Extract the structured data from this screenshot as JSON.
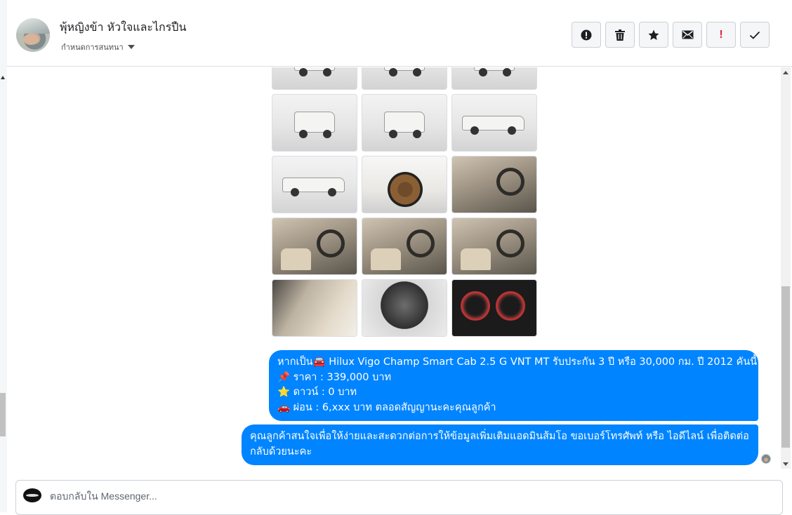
{
  "header": {
    "contact_name": "พุ้หญิงข้า หัวใจและไกรปืน",
    "conversation_settings": "กำหนดการสนทนา"
  },
  "toolbar": {
    "buttons": [
      {
        "name": "report-spam-button",
        "icon": "alert-circle-icon"
      },
      {
        "name": "delete-button",
        "icon": "trash-icon"
      },
      {
        "name": "star-button",
        "icon": "star-icon"
      },
      {
        "name": "mark-unread-button",
        "icon": "envelope-icon"
      },
      {
        "name": "follow-up-button",
        "icon": "exclamation-icon"
      },
      {
        "name": "mark-done-button",
        "icon": "check-icon"
      }
    ]
  },
  "photo_album": {
    "photo_count_visible": 15
  },
  "messages": {
    "offer": {
      "line1": "หากเป็น🚘 Hilux Vigo Champ Smart Cab 2.5 G VNT MT รับประกัน 3 ปี หรือ 30,000 กม. ปี 2012 คันนี้",
      "line2": "📌 ราคา : 339,000 บาท",
      "line3": "⭐ ดาวน์ : 0 บาท",
      "line4": "🚗 ผ่อน : 6,xxx บาท ตลอดสัญญานะคะคุณลูกค้า"
    },
    "followup": "คุณลูกค้าสนใจเพื่อให้ง่ายและสะดวกต่อการให้ข้อมูลเพิ่มเติมแอดมินส้มโอ ขอเบอร์โทรศัพท์ หรือ ไอดีไลน์ เพื่อติดต่อกลับด้วยนะคะ"
  },
  "composer": {
    "placeholder": "ตอบกลับใน Messenger..."
  },
  "colors": {
    "bubble": "#0084ff",
    "follow_up_icon": "#e41e3f"
  }
}
